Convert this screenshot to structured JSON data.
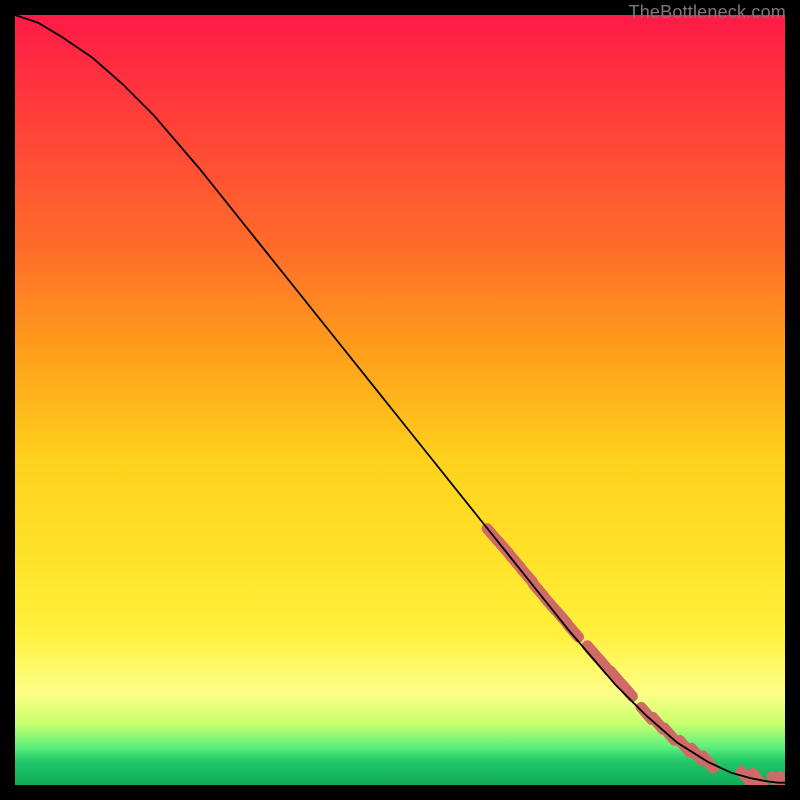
{
  "source_label": "TheBottleneck.com",
  "chart_data": {
    "type": "line",
    "title": "",
    "xlabel": "",
    "ylabel": "",
    "xlim": [
      0,
      100
    ],
    "ylim": [
      0,
      100
    ],
    "grid": false,
    "series": [
      {
        "name": "curve",
        "style": "line",
        "color": "#000000",
        "x": [
          0,
          3,
          6,
          10,
          14,
          18,
          24,
          30,
          36,
          42,
          48,
          54,
          60,
          66,
          72,
          78,
          82,
          86,
          90,
          93,
          95.5,
          97.5,
          99,
          100
        ],
        "y": [
          100,
          99,
          97.2,
          94.5,
          91,
          87,
          80,
          72.5,
          65,
          57.5,
          50,
          42.5,
          35,
          27.5,
          20,
          13,
          9,
          5.5,
          3,
          1.6,
          0.9,
          0.5,
          0.3,
          0.3
        ]
      },
      {
        "name": "markers",
        "style": "marker",
        "color": "#cf6a67",
        "x": [
          62,
          63.5,
          65,
          66.5,
          68,
          69.5,
          71,
          72.5,
          75,
          76.5,
          78,
          79.5,
          82,
          83.5,
          85,
          87,
          88.5,
          90,
          95,
          96.5,
          99,
          100
        ],
        "y": [
          32.5,
          30.8,
          29,
          27.2,
          25.3,
          23.5,
          21.8,
          20,
          17.3,
          15.6,
          14,
          12.3,
          9.3,
          8,
          6.6,
          5,
          4,
          3,
          1,
          0.7,
          0.3,
          0.3
        ]
      }
    ]
  }
}
